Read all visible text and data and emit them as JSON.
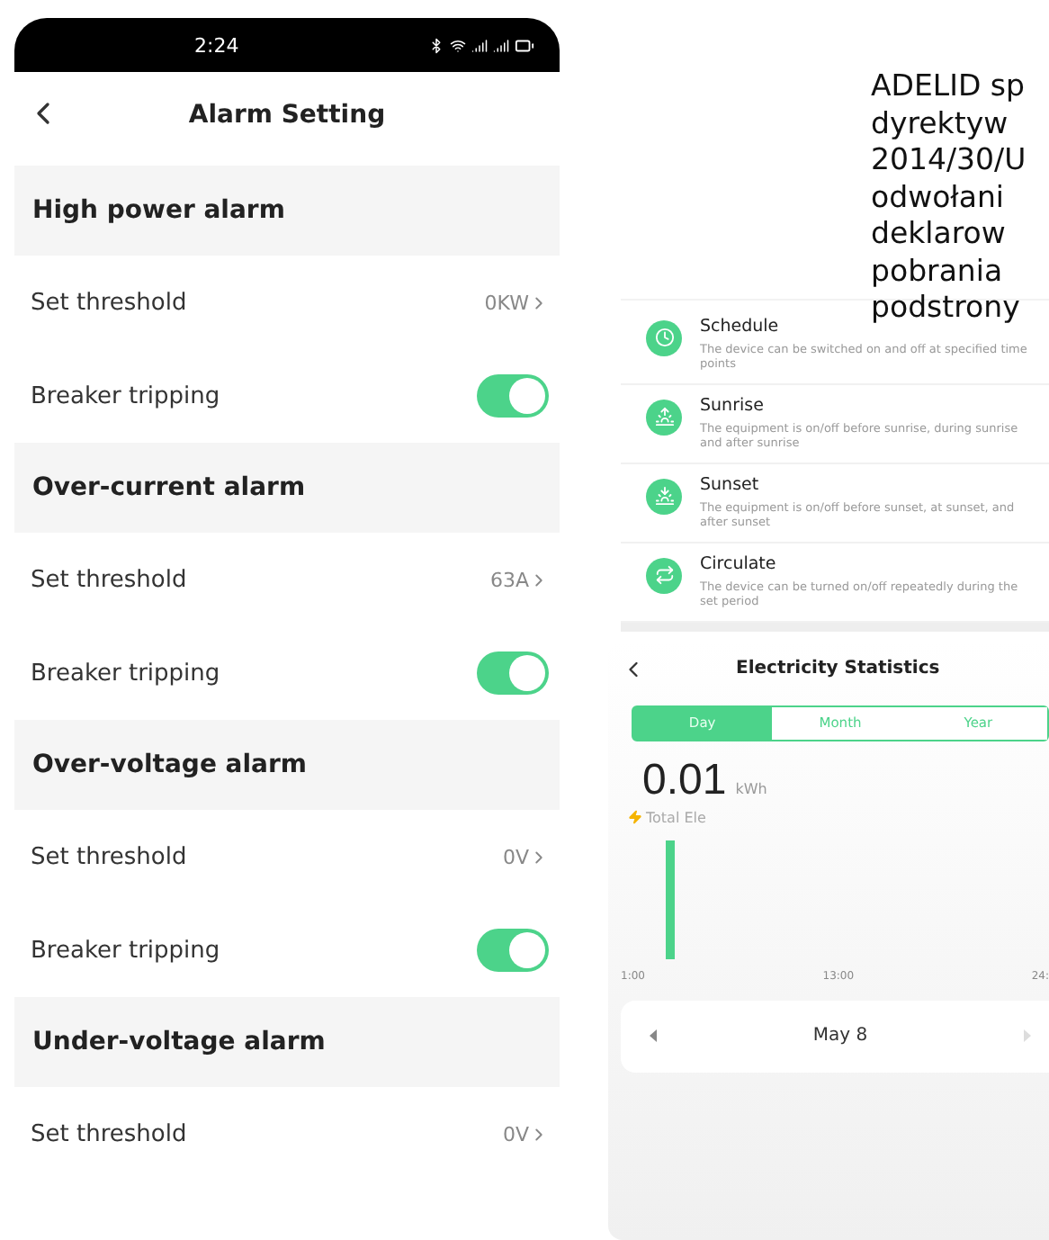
{
  "phone": {
    "status_bar": {
      "time": "2:24"
    },
    "title": "Alarm Setting",
    "sections": [
      {
        "title": "High power alarm",
        "rows": [
          {
            "kind": "value",
            "label": "Set threshold",
            "value": "0KW"
          },
          {
            "kind": "toggle",
            "label": "Breaker tripping",
            "on": true
          }
        ]
      },
      {
        "title": "Over-current alarm",
        "rows": [
          {
            "kind": "value",
            "label": "Set threshold",
            "value": "63A"
          },
          {
            "kind": "toggle",
            "label": "Breaker tripping",
            "on": true
          }
        ]
      },
      {
        "title": "Over-voltage alarm",
        "rows": [
          {
            "kind": "value",
            "label": "Set threshold",
            "value": "0V"
          },
          {
            "kind": "toggle",
            "label": "Breaker tripping",
            "on": true
          }
        ]
      },
      {
        "title": "Under-voltage alarm",
        "rows": [
          {
            "kind": "value",
            "label": "Set threshold",
            "value": "0V"
          }
        ]
      }
    ]
  },
  "description": {
    "lines": [
      "ADELID sp",
      "dyrektyw",
      "2014/30/U",
      "odwołani",
      "deklarow",
      "pobrania",
      "podstrony"
    ]
  },
  "modes": [
    {
      "kind": "schedule",
      "title": "Schedule",
      "text": "The device can be switched on and off at specified time points"
    },
    {
      "kind": "sunrise",
      "title": "Sunrise",
      "text": "The equipment is on/off before sunrise, during sunrise and after sunrise"
    },
    {
      "kind": "sunset",
      "title": "Sunset",
      "text": "The equipment is on/off before sunset, at sunset, and after sunset"
    },
    {
      "kind": "circulate",
      "title": "Circulate",
      "text": "The device can be turned on/off repeatedly during the set period"
    }
  ],
  "statistics": {
    "title": "Electricity Statistics",
    "tabs": [
      {
        "label": "Day",
        "selected": true
      },
      {
        "label": "Month",
        "selected": false
      },
      {
        "label": "Year",
        "selected": false
      }
    ],
    "total": "0.01",
    "unit": "kWh",
    "caption": "Total Ele",
    "axis_labels": [
      "1:00",
      "13:00",
      "24:"
    ],
    "date": "May 8"
  }
}
